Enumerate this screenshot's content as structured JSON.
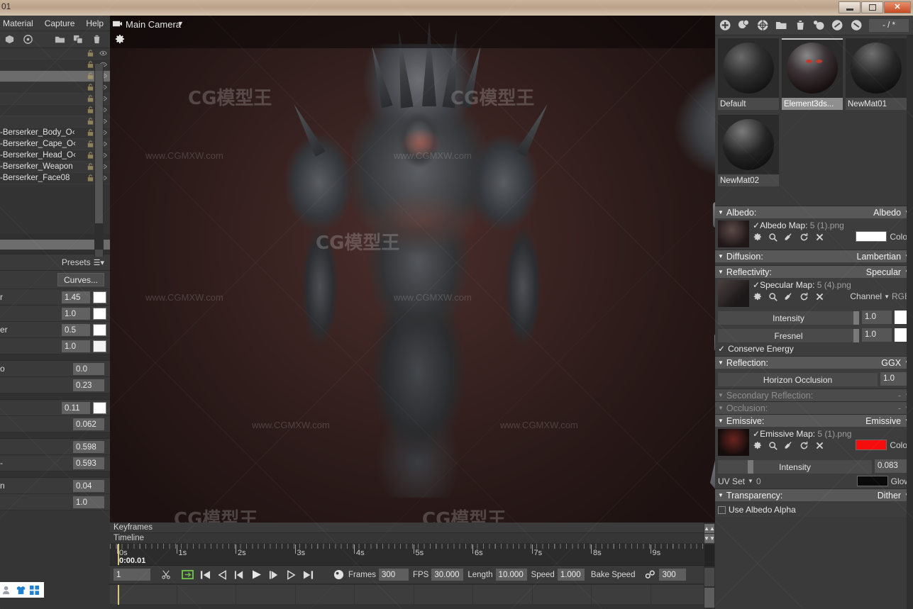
{
  "window": {
    "title": "01",
    "buttons": {
      "minimize": "minimize-icon",
      "maximize": "maximize-icon",
      "close": "✕"
    }
  },
  "menu": {
    "items": [
      "Material",
      "Capture",
      "Help"
    ]
  },
  "left_toolbar": {
    "icons": [
      "cube-icon",
      "sphere-icon",
      "folder-icon",
      "duplicate-icon",
      "trash-icon"
    ]
  },
  "viewport": {
    "camera_label": "Main Camera",
    "camera_icon": "camera-icon",
    "gear_icon": "gear-icon",
    "background_color": "#3a2422",
    "watermark_text": "www.CGMXW.com",
    "watermark_logo": "CG模型王"
  },
  "object_list": {
    "rows": [
      {
        "label": "",
        "selected": false
      },
      {
        "label": "",
        "selected": false
      },
      {
        "label": "",
        "selected": true
      },
      {
        "label": "",
        "selected": false
      },
      {
        "label": "",
        "selected": false
      },
      {
        "label": "",
        "selected": false
      },
      {
        "label": "",
        "selected": false
      },
      {
        "label": "-Berserker_Body_O‹",
        "selected": false
      },
      {
        "label": "-Berserker_Cape_O‹",
        "selected": false
      },
      {
        "label": "-Berserker_Head_O‹",
        "selected": false
      },
      {
        "label": "-Berserker_Weapon",
        "selected": false
      },
      {
        "label": "-Berserker_Face08",
        "selected": false
      }
    ],
    "row_icons": [
      "lock-icon",
      "eye-icon"
    ]
  },
  "left_properties": {
    "presets_label": "Presets",
    "presets_icon": "hamburger-icon",
    "curves_button": "Curves...",
    "rows": [
      {
        "label": "r",
        "value": "1.45",
        "swatch": "#ffffff"
      },
      {
        "label": "",
        "value": "1.0",
        "swatch": "#ffffff"
      },
      {
        "label": "er",
        "value": "0.5",
        "swatch": "#ffffff"
      },
      {
        "label": "",
        "value": "1.0",
        "swatch": "#f2f2f2"
      },
      {
        "label": "o",
        "value": "0.0",
        "swatch": null
      },
      {
        "label": "",
        "value": "0.23",
        "swatch": null
      },
      {
        "label": "",
        "value": "0.11",
        "swatch": "#ffffff"
      },
      {
        "label": "",
        "value": "0.062",
        "swatch": null
      },
      {
        "label": "",
        "value": "0.598",
        "swatch": null
      },
      {
        "label": "-",
        "value": "0.593",
        "swatch": null
      },
      {
        "label": "n",
        "value": "0.04",
        "swatch": null
      },
      {
        "label": "",
        "value": "1.0",
        "swatch": null
      }
    ],
    "bottom_icons": [
      "character-icon",
      "shirt-icon",
      "grid-icon"
    ]
  },
  "timeline": {
    "keyframes_label": "Keyframes",
    "timeline_label": "Timeline",
    "seconds": [
      "0s",
      "1s",
      "2s",
      "3s",
      "4s",
      "5s",
      "6s",
      "7s",
      "8s",
      "9s"
    ],
    "current_time": "0:00.01",
    "frame_field": "1",
    "scissors_icon": "scissors-icon",
    "loop_icon": "loop-icon",
    "transport": [
      "skip-start-icon",
      "step-back-key-icon",
      "step-back-icon",
      "play-icon",
      "step-forward-icon",
      "step-forward-key-icon",
      "skip-end-icon"
    ],
    "record_icon": "record-icon",
    "fields": [
      {
        "label": "Frames",
        "value": "300"
      },
      {
        "label": "FPS",
        "value": "30.000"
      },
      {
        "label": "Length",
        "value": "10.000"
      },
      {
        "label": "Speed",
        "value": "1.000"
      }
    ],
    "bake_speed_label": "Bake Speed",
    "bake_link_icon": "link-icon",
    "bake_value": "300"
  },
  "material_panel": {
    "toolbar_icons": [
      "add-material-icon",
      "duplicate-material-icon",
      "checker-icon",
      "folder-icon",
      "trash-icon",
      "assign-icon",
      "select-icon",
      "deselect-icon"
    ],
    "counter": "- / *",
    "materials": [
      {
        "name": "Default",
        "selected": false
      },
      {
        "name": "Element3ds...",
        "selected": true
      },
      {
        "name": "NewMat01",
        "selected": false
      },
      {
        "name": "NewMat02",
        "selected": false
      }
    ]
  },
  "properties": {
    "albedo": {
      "title": "Albedo:",
      "mode": "Albedo",
      "map_label": "Albedo Map:",
      "map_file": "5 (1).png",
      "map_checked": true,
      "icons": [
        "gear-icon",
        "search-icon",
        "eyedropper-icon",
        "refresh-icon",
        "close-icon"
      ],
      "color_label": "Color",
      "color_value": "#ffffff"
    },
    "diffusion": {
      "title": "Diffusion:",
      "mode": "Lambertian"
    },
    "reflectivity": {
      "title": "Reflectivity:",
      "mode": "Specular",
      "map_label": "Specular Map:",
      "map_file": "5 (4).png",
      "map_checked": true,
      "icons": [
        "gear-icon",
        "search-icon",
        "eyedropper-icon",
        "refresh-icon",
        "close-icon"
      ],
      "channel_label": "Channel",
      "channel_value": "RGB",
      "intensity_label": "Intensity",
      "intensity_value": "1.0",
      "intensity_color": "#ffffff",
      "fresnel_label": "Fresnel",
      "fresnel_value": "1.0",
      "fresnel_color": "#ffffff",
      "conserve_energy_label": "Conserve Energy",
      "conserve_energy_checked": true
    },
    "reflection": {
      "title": "Reflection:",
      "mode": "GGX",
      "horizon_label": "Horizon Occlusion",
      "horizon_value": "1.0"
    },
    "secondary_reflection": {
      "title": "Secondary Reflection:",
      "mode": "-"
    },
    "occlusion": {
      "title": "Occlusion:",
      "mode": "-"
    },
    "emissive": {
      "title": "Emissive:",
      "mode": "Emissive",
      "map_label": "Emissive Map:",
      "map_file": "5 (1).png",
      "map_checked": true,
      "icons": [
        "gear-icon",
        "search-icon",
        "eyedropper-icon",
        "refresh-icon",
        "close-icon"
      ],
      "color_label": "Color",
      "color_value": "#f50c0c",
      "intensity_label": "Intensity",
      "intensity_value": "0.083",
      "uvset_label": "UV Set",
      "uvset_value": "0",
      "glow_label": "Glow",
      "glow_color": "#0a0a0a"
    },
    "transparency": {
      "title": "Transparency:",
      "mode": "Dither",
      "use_albedo_alpha_label": "Use Albedo Alpha",
      "use_albedo_alpha_checked": false
    }
  }
}
